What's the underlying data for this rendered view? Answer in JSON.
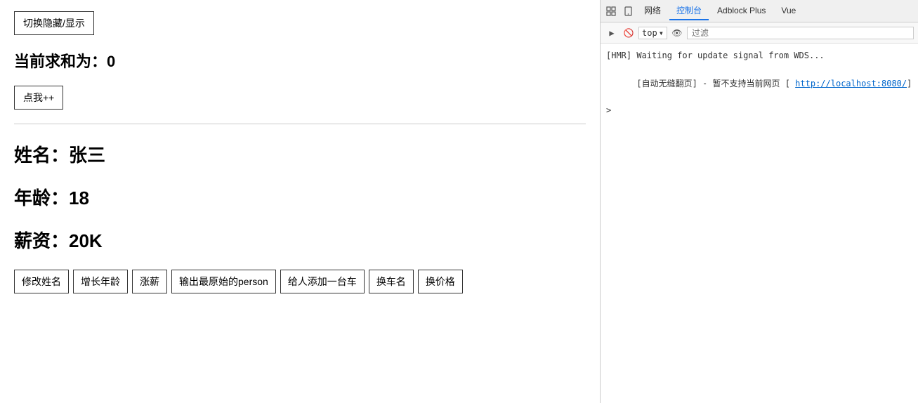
{
  "app": {
    "toggle_button_label": "切换隐藏/显示",
    "sum_label": "当前求和为：",
    "sum_value": "0",
    "click_button_label": "点我++",
    "person": {
      "name_label": "姓名：",
      "name_value": "张三",
      "age_label": "年龄：",
      "age_value": "18",
      "salary_label": "薪资：",
      "salary_value": "20K"
    },
    "action_buttons": [
      {
        "label": "修改姓名",
        "name": "modify-name-button"
      },
      {
        "label": "增长年龄",
        "name": "increase-age-button"
      },
      {
        "label": "涨薪",
        "name": "increase-salary-button"
      },
      {
        "label": "输出最原始的person",
        "name": "output-person-button"
      },
      {
        "label": "给人添加一台车",
        "name": "add-car-button"
      },
      {
        "label": "换车名",
        "name": "change-car-name-button"
      },
      {
        "label": "换价格",
        "name": "change-price-button"
      }
    ]
  },
  "devtools": {
    "tabs": [
      {
        "label": "网络",
        "active": false
      },
      {
        "label": "控制台",
        "active": true
      },
      {
        "label": "Adblock Plus",
        "active": false
      },
      {
        "label": "Vue",
        "active": false
      }
    ],
    "toolbar": {
      "top_select": "top",
      "filter_placeholder": "过滤"
    },
    "console_lines": [
      {
        "text": "[HMR] Waiting for update signal from WDS...",
        "type": "info"
      },
      {
        "text": "[自动无缝翻页] - 暂不支持当前网页 [ ",
        "link_text": "http://localhost:8080/",
        "link_url": "http://localhost:8080/",
        "type": "info-link"
      }
    ]
  }
}
